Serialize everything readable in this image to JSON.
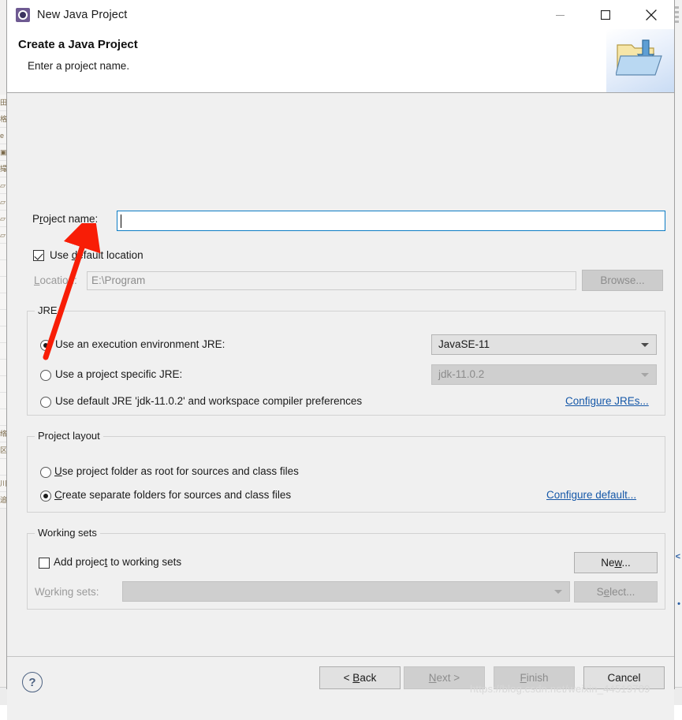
{
  "window": {
    "title": "New Java Project",
    "icon": "eclipse-wizard-icon",
    "minimize_label": "–",
    "maximize_label": "□",
    "close_label": "✕"
  },
  "header": {
    "title": "Create a Java Project",
    "subtitle": "Enter a project name.",
    "banner_icon": "java-project-folder-icon"
  },
  "form": {
    "project_name_label": "Project name:",
    "project_name_value": "",
    "use_default_location_label": "Use default location",
    "use_default_location_checked": true,
    "location_label": "Location:",
    "location_value": "E:\\Program",
    "location_enabled": false,
    "browse_label": "Browse...",
    "browse_enabled": false
  },
  "jre": {
    "group_title": "JRE",
    "options": [
      {
        "label": "Use an execution environment JRE:",
        "selected": true
      },
      {
        "label": "Use a project specific JRE:",
        "selected": false
      },
      {
        "label": "Use default JRE 'jdk-11.0.2' and workspace compiler preferences",
        "selected": false
      }
    ],
    "execution_env_value": "JavaSE-11",
    "project_jre_value": "jdk-11.0.2",
    "project_jre_enabled": false,
    "configure_link": "Configure JREs..."
  },
  "project_layout": {
    "group_title": "Project layout",
    "options": [
      {
        "label": "Use project folder as root for sources and class files",
        "selected": false
      },
      {
        "label": "Create separate folders for sources and class files",
        "selected": true
      }
    ],
    "configure_link": "Configure default..."
  },
  "working_sets": {
    "group_title": "Working sets",
    "add_label": "Add project to working sets",
    "add_checked": false,
    "new_label": "New...",
    "working_sets_label": "Working sets:",
    "working_sets_value": "",
    "working_sets_enabled": false,
    "select_label": "Select...",
    "select_enabled": false
  },
  "footer": {
    "help_label": "?",
    "back_label": "< Back",
    "next_label": "Next >",
    "finish_label": "Finish",
    "cancel_label": "Cancel",
    "back_enabled": true,
    "next_enabled": false,
    "finish_enabled": false,
    "cancel_enabled": true
  },
  "annotation": {
    "type": "red-arrow",
    "color": "#f81d06",
    "points_to": "project-name-input"
  },
  "watermark": {
    "text": "https://blog.csdn.net/weixin_44519789"
  },
  "colors": {
    "focus_border": "#0c7cc4",
    "link": "#1658a8",
    "dialog_bg": "#f0f0f0",
    "annotation_red": "#f81d06"
  }
}
